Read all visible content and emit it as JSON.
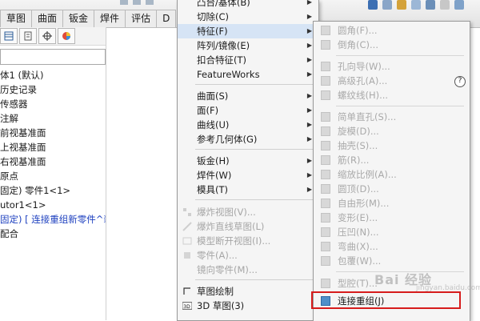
{
  "toolbar": {
    "tabs": [
      "草图",
      "曲面",
      "钣金",
      "焊件",
      "评估",
      "D"
    ]
  },
  "left_panel": {
    "tree_items": [
      {
        "label": "体1 (默认)",
        "style": "normal"
      },
      {
        "label": "历史记录",
        "style": "normal"
      },
      {
        "label": "传感器",
        "style": "normal"
      },
      {
        "label": "注解",
        "style": "normal"
      },
      {
        "label": "前视基准面",
        "style": "normal"
      },
      {
        "label": "上视基准面",
        "style": "normal"
      },
      {
        "label": "右视基准面",
        "style": "normal"
      },
      {
        "label": "原点",
        "style": "normal"
      },
      {
        "label": "固定) 零件1<1>",
        "style": "normal"
      },
      {
        "label": "utor1<1>",
        "style": "normal"
      },
      {
        "label": "固定) [ 连接重组新零件^装",
        "style": "blue"
      },
      {
        "label": "配合",
        "style": "normal"
      }
    ]
  },
  "main_menu": {
    "items": [
      {
        "label": "凸台/基体(B)",
        "submenu": true,
        "disabled": false
      },
      {
        "label": "切除(C)",
        "submenu": true,
        "disabled": false
      },
      {
        "label": "特征(F)",
        "submenu": true,
        "disabled": false,
        "hover": true
      },
      {
        "label": "阵列/镜像(E)",
        "submenu": true,
        "disabled": false
      },
      {
        "label": "扣合特征(T)",
        "submenu": true,
        "disabled": false
      },
      {
        "label": "FeatureWorks",
        "submenu": true,
        "disabled": false
      },
      {
        "label": "曲面(S)",
        "submenu": true,
        "disabled": false
      },
      {
        "label": "面(F)",
        "submenu": true,
        "disabled": false
      },
      {
        "label": "曲线(U)",
        "submenu": true,
        "disabled": false
      },
      {
        "label": "参考几何体(G)",
        "submenu": true,
        "disabled": false
      },
      {
        "label": "钣金(H)",
        "submenu": true,
        "disabled": false
      },
      {
        "label": "焊件(W)",
        "submenu": true,
        "disabled": false
      },
      {
        "label": "模具(T)",
        "submenu": true,
        "disabled": false
      },
      {
        "label": "爆炸视图(V)...",
        "submenu": false,
        "disabled": true
      },
      {
        "label": "爆炸直线草图(L)",
        "submenu": false,
        "disabled": true
      },
      {
        "label": "模型断开视图(I)...",
        "submenu": false,
        "disabled": true
      },
      {
        "label": "零件(A)...",
        "submenu": false,
        "disabled": true
      },
      {
        "label": "镜向零件(M)...",
        "submenu": false,
        "disabled": true
      },
      {
        "label": "草图绘制",
        "submenu": false,
        "disabled": false
      },
      {
        "label": "3D 草图(3)",
        "submenu": false,
        "disabled": false
      }
    ]
  },
  "sub_menu": {
    "items": [
      {
        "label": "圆角(F)...",
        "enabled": false
      },
      {
        "label": "倒角(C)...",
        "enabled": false
      },
      {
        "label": "孔向导(W)...",
        "enabled": false
      },
      {
        "label": "高级孔(A)...",
        "enabled": false
      },
      {
        "label": "螺纹线(H)...",
        "enabled": false
      },
      {
        "label": "简单直孔(S)...",
        "enabled": false
      },
      {
        "label": "旋模(D)...",
        "enabled": false
      },
      {
        "label": "抽壳(S)...",
        "enabled": false
      },
      {
        "label": "筋(R)...",
        "enabled": false
      },
      {
        "label": "缩放比例(A)...",
        "enabled": false
      },
      {
        "label": "圆顶(D)...",
        "enabled": false
      },
      {
        "label": "自由形(M)...",
        "enabled": false
      },
      {
        "label": "变形(E)...",
        "enabled": false
      },
      {
        "label": "压凹(N)...",
        "enabled": false
      },
      {
        "label": "弯曲(X)...",
        "enabled": false
      },
      {
        "label": "包覆(W)...",
        "enabled": false
      },
      {
        "label": "型腔(T)...",
        "enabled": false
      },
      {
        "label": "连接重组(J)",
        "enabled": true
      }
    ]
  },
  "help_glyph": "?",
  "watermark": {
    "text": "Bai 经验",
    "url": "jingyan.baidu.com"
  }
}
